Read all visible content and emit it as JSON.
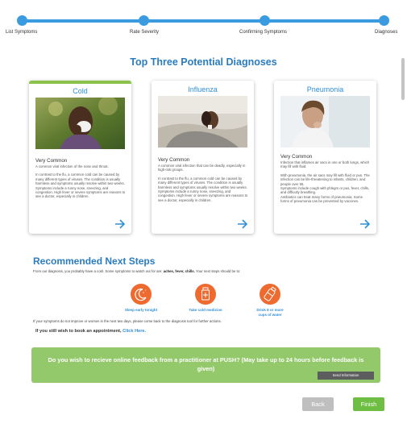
{
  "stepper": {
    "steps": [
      "List Symptoms",
      "Rate Severity",
      "Confirming Symptoms",
      "Diagnoses"
    ]
  },
  "page_title": "Top Three Potential Diagnoses",
  "diagnoses": [
    {
      "name": "Cold",
      "selected": true,
      "frequency": "Very Common",
      "paragraphs": [
        "A common viral infection of the nose and throat.",
        "In contrast to the flu, a common cold can be caused by many different types of viruses. The condition is usually harmless and symptoms usually resolve within two weeks.",
        "Symptoms include a runny nose, sneezing, and congestion. High fever or severe symptoms are reasons to see a doctor, especially in children."
      ]
    },
    {
      "name": "Influenza",
      "selected": false,
      "frequency": "Very Common",
      "paragraphs": [
        "A common viral infection that can be deadly, especially in high-risk groups.",
        "In contrast to the flu, a common cold can be caused by many different types of viruses. The condition is usually harmless and symptoms usually resolve within two weeks.",
        "Symptoms include a runny nose, sneezing, and congestion. High fever or severe symptoms are reasons to see a doctor, especially in children."
      ]
    },
    {
      "name": "Pneumonia",
      "selected": false,
      "frequency": "Very Common",
      "paragraphs": [
        "Infection that inflames air sacs in one or both lungs, which may fill with fluid.",
        "With pneumonia, the air sacs may fill with fluid or pus. The infection can be life-threatening to infants, children, and people over 65.",
        "Symptoms include cough with phlegm or pus, fever, chills, and difficulty breathing.",
        "Antibiotics can treat many forms of pneumonia. Some forms of pneumonia can be prevented by vaccines."
      ]
    }
  ],
  "next_steps": {
    "title": "Recommended Next Steps",
    "diagnosis_prefix": "From our diagnosis, you probably have a cold. Some symptoms to watch out for are: ",
    "watch_symptoms": "aches, fever, chills.",
    "diagnosis_suffix": " Your next steps should be to:",
    "recommendations": [
      {
        "label": "Sleep early tonight",
        "icon": "sleep-moon-icon"
      },
      {
        "label": "Take cold medicine",
        "icon": "medicine-bottle-icon"
      },
      {
        "label": "Drink 8 or more cups of water",
        "icon": "water-bottle-icon"
      }
    ],
    "worse_text": "If your symptoms do not improve or worsen in the next two days, please come back to the diagnosis tool for further actions.",
    "book_prefix": "If you still wish to book an appointment, ",
    "book_link": "Click Here."
  },
  "feedback": {
    "question": "Do you wish to recieve online feedback from a practitioner at PUSH? (May take up to 24 hours before feedback is given)",
    "send_label": "Send Information"
  },
  "nav": {
    "back_label": "Back",
    "finish_label": "Finish"
  },
  "colors": {
    "accent_blue": "#2a7cbf",
    "stepper_blue": "#3a9be0",
    "selected_green": "#8bc34a",
    "feedback_green": "#93c96a",
    "finish_green": "#6fbe44",
    "icon_orange": "#ee6a2f"
  }
}
